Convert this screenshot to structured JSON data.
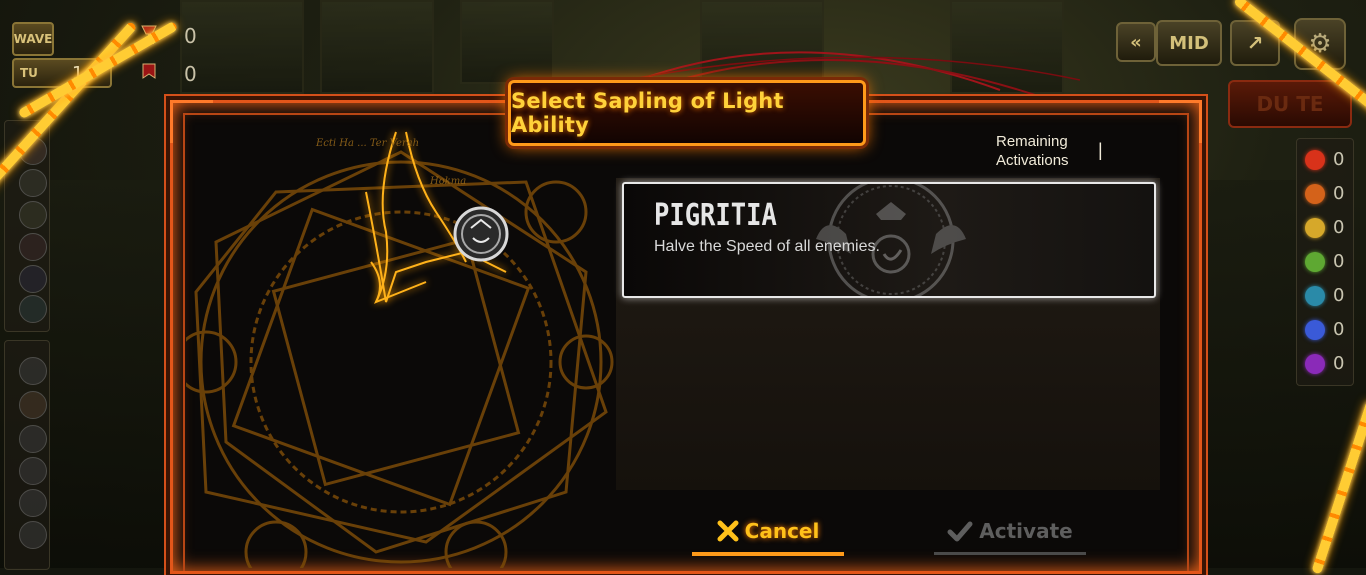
{
  "hud": {
    "wave_label": "WAVE",
    "turn_label": "TU",
    "turn_value": "1",
    "counter_top": "0",
    "counter_bottom": "0",
    "speed_label": "MID",
    "dupe_label": "DU  TE"
  },
  "dialog": {
    "title": "Select Sapling of Light Ability",
    "remaining_label": "Remaining Activations",
    "remaining_value": "|",
    "circle_script_1": "Ecti Ha ... Ter Verah",
    "circle_script_2": "Hokma"
  },
  "ability": {
    "name": "PIGRITIA",
    "description": "Halve the Speed of all enemies.",
    "emblem_icon": "winged-seal-icon"
  },
  "buttons": {
    "cancel_label": "Cancel",
    "cancel_icon": "close-icon",
    "activate_label": "Activate",
    "activate_icon": "checkmark-icon",
    "activate_enabled": false
  },
  "resources": [
    {
      "icon": "red-flame-gem-icon",
      "color": "#d8321a",
      "value": "0"
    },
    {
      "icon": "orange-cross-gem-icon",
      "color": "#d4621a",
      "value": "0"
    },
    {
      "icon": "yellow-gem-icon",
      "color": "#d6a82a",
      "value": "0"
    },
    {
      "icon": "green-gem-icon",
      "color": "#5ea832",
      "value": "0"
    },
    {
      "icon": "teal-gem-icon",
      "color": "#2a8aa8",
      "value": "0"
    },
    {
      "icon": "blue-crystal-gem-icon",
      "color": "#3a5ad8",
      "value": "0"
    },
    {
      "icon": "purple-gem-icon",
      "color": "#8a2ab8",
      "value": "0"
    }
  ],
  "colors": {
    "accent": "#ff9a1a",
    "frame": "#e2561a",
    "title_text": "#ffd23a"
  }
}
